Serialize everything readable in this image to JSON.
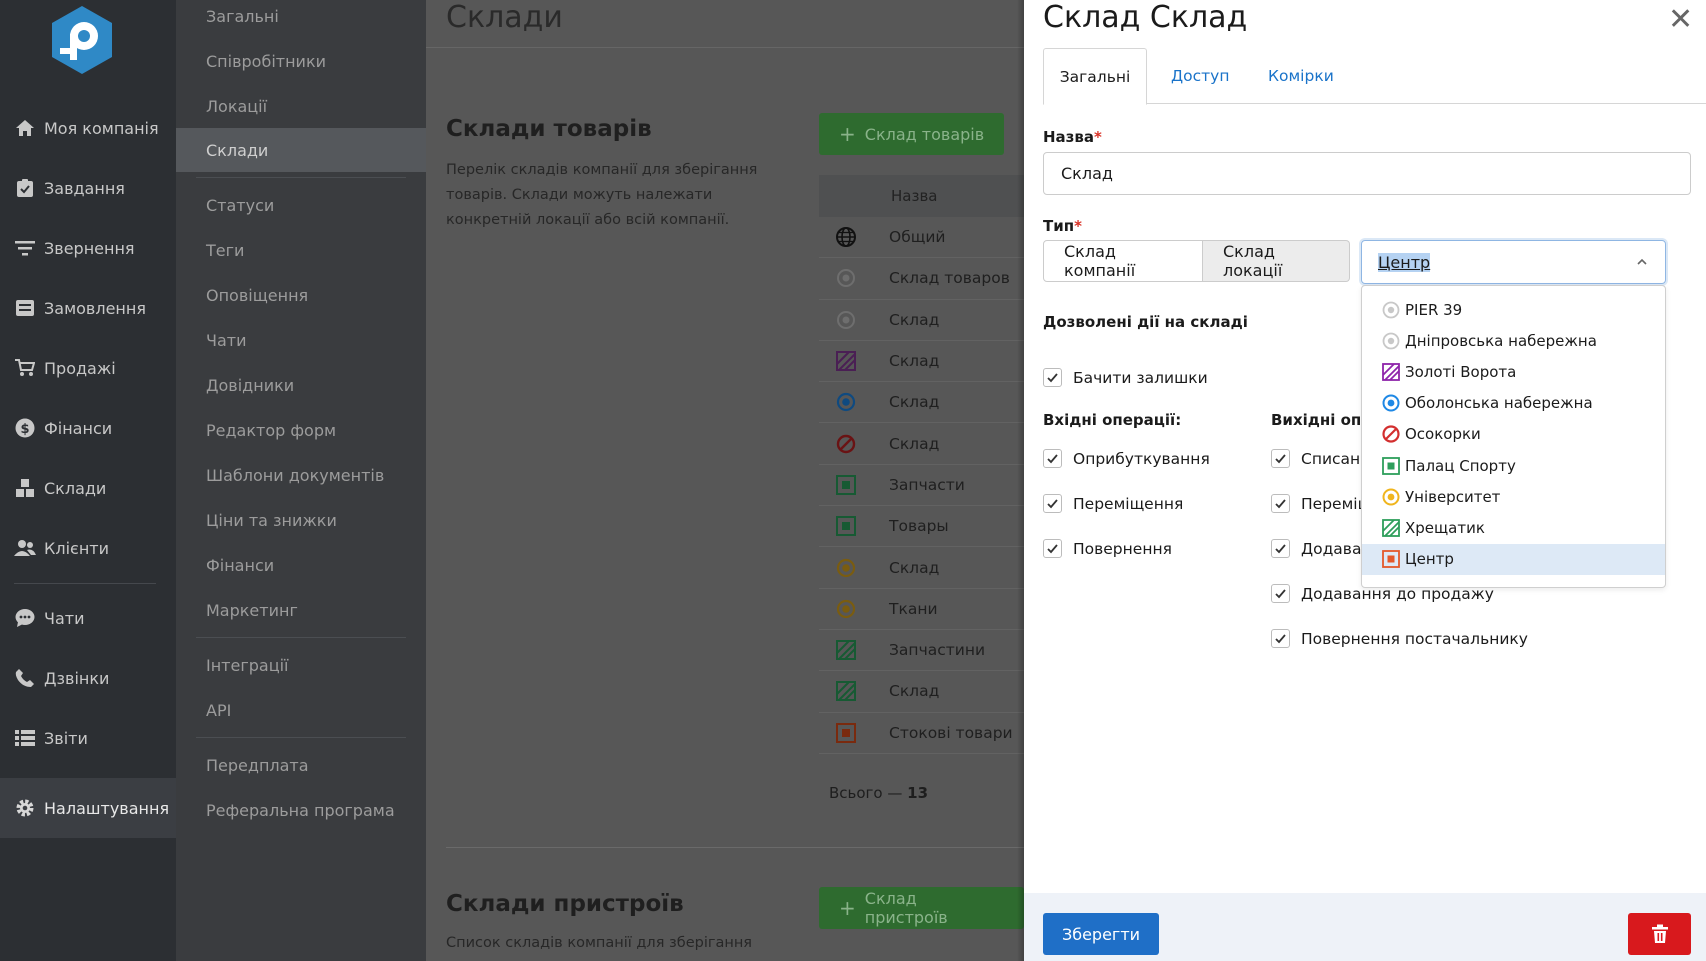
{
  "main_nav": {
    "items": [
      {
        "label": "Моя компанія",
        "icon": "home-icon"
      },
      {
        "label": "Завдання",
        "icon": "clipboard-icon"
      },
      {
        "label": "Звернення",
        "icon": "filter-icon"
      },
      {
        "label": "Замовлення",
        "icon": "orders-icon"
      },
      {
        "label": "Продажі",
        "icon": "cart-icon"
      },
      {
        "label": "Фінанси",
        "icon": "dollar-icon"
      },
      {
        "label": "Склади",
        "icon": "boxes-icon"
      },
      {
        "label": "Клієнти",
        "icon": "users-icon"
      },
      {
        "label": "Чати",
        "icon": "chat-icon"
      },
      {
        "label": "Дзвінки",
        "icon": "phone-icon"
      },
      {
        "label": "Звіти",
        "icon": "list-icon"
      },
      {
        "label": "Налаштування",
        "icon": "gear-icon"
      }
    ],
    "active": "Налаштування"
  },
  "settings_nav": {
    "items": [
      "Загальні",
      "Співробітники",
      "Локації",
      "Склади",
      "Статуси",
      "Теги",
      "Оповіщення",
      "Чати",
      "Довідники",
      "Редактор форм",
      "Шаблони документів",
      "Ціни та знижки",
      "Фінанси",
      "Маркетинг",
      "Інтеграції",
      "API",
      "Передплата",
      "Реферальна програма"
    ],
    "active": "Склади"
  },
  "content": {
    "page_title": "Склади",
    "goods_section": {
      "title": "Склади товарів",
      "description": "Перелік складів компанії для зберігання товарів. Склади можуть належати конкретній локації або всій компанії.",
      "add_button": "Склад товарів",
      "column_name": "Назва",
      "rows": [
        {
          "name": "Общий",
          "icon": "globe-icon"
        },
        {
          "name": "Склад товаров",
          "icon": "grey-circle-icon"
        },
        {
          "name": "Склад",
          "icon": "grey-circle-icon"
        },
        {
          "name": "Склад",
          "icon": "purple-stripes-icon"
        },
        {
          "name": "Склад",
          "icon": "blue-circle-icon"
        },
        {
          "name": "Склад",
          "icon": "red-prohibited-icon"
        },
        {
          "name": "Запчасти",
          "icon": "green-square-icon"
        },
        {
          "name": "Товары",
          "icon": "green-square-icon"
        },
        {
          "name": "Склад",
          "icon": "yellow-circle-icon"
        },
        {
          "name": "Ткани",
          "icon": "yellow-circle-icon"
        },
        {
          "name": "Запчастини",
          "icon": "green-stripes-icon"
        },
        {
          "name": "Склад",
          "icon": "green-stripes-icon"
        },
        {
          "name": "Стокові товари",
          "icon": "orange-square-icon"
        }
      ],
      "total_label": "Всього —",
      "total_value": "13"
    },
    "devices_section": {
      "title": "Склади пристроїв",
      "description": "Список складів компанії для зберігання",
      "add_button": "Склад пристроїв"
    }
  },
  "panel": {
    "title": "Склад Склад",
    "tabs": [
      "Загальні",
      "Доступ",
      "Комірки"
    ],
    "active_tab": "Загальні",
    "name_label": "Назва",
    "name_value": "Склад",
    "type_label": "Тип",
    "type_options": [
      "Склад компанії",
      "Склад локації"
    ],
    "type_selected": "Склад локації",
    "location_select": {
      "value": "Центр",
      "options": [
        {
          "label": "PIER 39",
          "icon": "grey-circle-icon"
        },
        {
          "label": "Дніпровська набережна",
          "icon": "grey-circle-icon"
        },
        {
          "label": "Золоті Ворота",
          "icon": "purple-stripes-icon"
        },
        {
          "label": "Оболонська набережна",
          "icon": "blue-circle-icon"
        },
        {
          "label": "Осокорки",
          "icon": "red-prohibited-icon"
        },
        {
          "label": "Палац Спорту",
          "icon": "green-square-icon"
        },
        {
          "label": "Університет",
          "icon": "yellow-circle-icon"
        },
        {
          "label": "Хрещатик",
          "icon": "green-stripes-icon"
        },
        {
          "label": "Центр",
          "icon": "orange-square-icon"
        }
      ]
    },
    "permissions_title": "Дозволені дії на складі",
    "see_stock": "Бачити залишки",
    "incoming_title": "Вхідні операції:",
    "incoming": [
      "Оприбуткування",
      "Переміщення",
      "Повернення"
    ],
    "outgoing_title": "Вихідні опе",
    "outgoing": [
      "Списанн",
      "Переміщ",
      "Додаван",
      "Додавання до продажу",
      "Повернення постачальнику"
    ],
    "save_button": "Зберегти"
  },
  "colors": {
    "accent_blue": "#1f6fc7",
    "danger_red": "#d8191d",
    "success_green": "#2e6b2f"
  }
}
